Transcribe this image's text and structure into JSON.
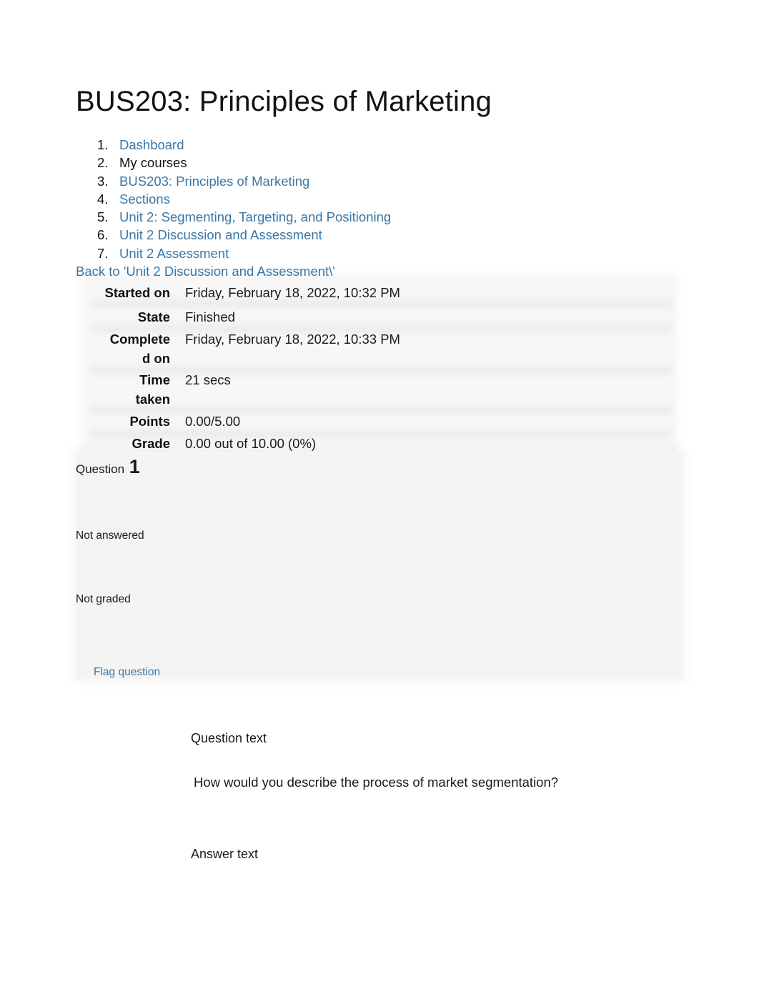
{
  "page": {
    "title": "BUS203: Principles of Marketing"
  },
  "breadcrumb": [
    {
      "num": "1.",
      "label": "Dashboard",
      "link": true
    },
    {
      "num": "2.",
      "label": "My courses",
      "link": false
    },
    {
      "num": "3.",
      "label": "BUS203: Principles of Marketing",
      "link": true
    },
    {
      "num": "4.",
      "label": "Sections",
      "link": true
    },
    {
      "num": "5.",
      "label": "Unit 2: Segmenting, Targeting, and Positioning",
      "link": true
    },
    {
      "num": "6.",
      "label": "Unit 2 Discussion and Assessment",
      "link": true
    },
    {
      "num": "7.",
      "label": "Unit 2 Assessment",
      "link": true
    }
  ],
  "back_link": "Back to 'Unit 2 Discussion and Assessment\\'",
  "summary": {
    "started_on": {
      "label": "Started on",
      "value": "Friday, February 18, 2022, 10:32 PM"
    },
    "state": {
      "label": "State",
      "value": "Finished"
    },
    "completed_on": {
      "label_line1": "Complete",
      "label_line2": "d on",
      "value": "Friday, February 18, 2022, 10:33 PM"
    },
    "time_taken": {
      "label_line1": "Time",
      "label_line2": "taken",
      "value": "21 secs"
    },
    "points": {
      "label": "Points",
      "value": "0.00/5.00"
    },
    "grade": {
      "label": "Grade",
      "value": "0.00 out of 10.00 (0%)"
    }
  },
  "question": {
    "prefix": "Question",
    "number": "1",
    "state": "Not answered",
    "grade": "Not graded",
    "flag_label": "Flag question",
    "question_text_label": "Question text",
    "question_text": "How would you describe the process of market segmentation?",
    "answer_text_label": "Answer text"
  },
  "colors": {
    "link": "#3a77a5",
    "text": "#1a1a1a",
    "panel": "#f4f4f4"
  }
}
